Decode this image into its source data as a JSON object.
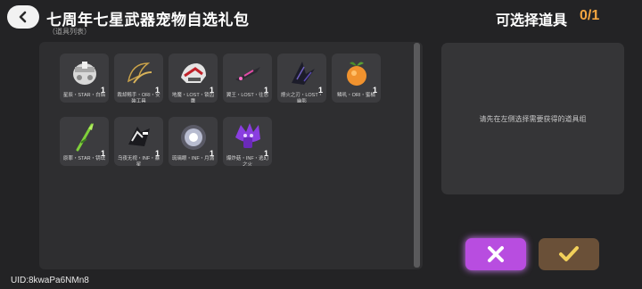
{
  "header": {
    "title": "七周年七星武器宠物自选礼包",
    "subtitle": "（道具列表）",
    "select_label": "可选择道具",
    "select_count": "0/1"
  },
  "items": [
    {
      "label": "星辰・STAR・白焰",
      "qty": "1",
      "icon": "white-armor-icon"
    },
    {
      "label": "裁却鲸手・ORI・安装工具",
      "qty": "1",
      "icon": "claw-weapon-icon"
    },
    {
      "label": "地魔・LOST・锁齿鹰",
      "qty": "1",
      "icon": "red-wing-helmet-icon"
    },
    {
      "label": "翼王・LOST・往思",
      "qty": "1",
      "icon": "pink-dagger-icon"
    },
    {
      "label": "燎火之刃・LOST・幽影",
      "qty": "1",
      "icon": "shadow-blade-icon"
    },
    {
      "label": "鳞叽・ORI・蜜橘",
      "qty": "1",
      "icon": "orange-fruit-icon"
    },
    {
      "label": "原罪・STAR・钥珐",
      "qty": "1",
      "icon": "green-staff-icon"
    },
    {
      "label": "乌夜无视・INF・暴星",
      "qty": "1",
      "icon": "dark-mecha-icon"
    },
    {
      "label": "琉璃眼・INF・月蒲",
      "qty": "1",
      "icon": "glowing-orb-icon"
    },
    {
      "label": "爆炸菇・INF・逃幻之火",
      "qty": "1",
      "icon": "purple-mushroom-icon"
    }
  ],
  "detail": {
    "hint": "请先在左侧选择需要获得的道具组"
  },
  "buttons": {
    "cancel_icon": "close-icon",
    "confirm_icon": "check-icon",
    "cancel_color": "#b84de0",
    "confirm_color": "#6a5038"
  },
  "footer": {
    "uid": "UID:8kwaPa6NMn8"
  },
  "colors": {
    "accent": "#f4a640",
    "background": "#232325"
  }
}
